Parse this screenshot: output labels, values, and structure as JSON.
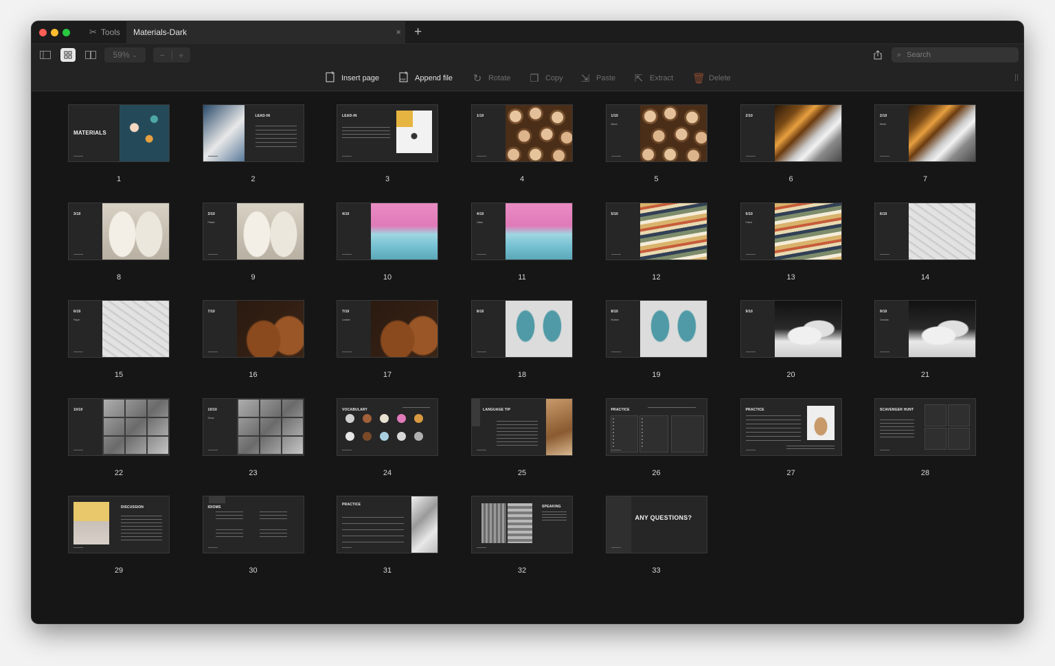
{
  "tabs": {
    "tools_label": "Tools",
    "document_title": "Materials-Dark",
    "close_glyph": "×",
    "new_tab_glyph": "+"
  },
  "toolbar": {
    "zoom_value": "59%",
    "zoom_out": "−",
    "zoom_in": "+",
    "search_placeholder": "Search"
  },
  "actions": [
    {
      "label": "Insert page",
      "icon": "insert-page-icon",
      "enabled": true
    },
    {
      "label": "Append file",
      "icon": "append-pdf-icon",
      "enabled": true
    },
    {
      "label": "Rotate",
      "icon": "rotate-icon",
      "enabled": false
    },
    {
      "label": "Copy",
      "icon": "copy-icon",
      "enabled": false
    },
    {
      "label": "Paste",
      "icon": "paste-icon",
      "enabled": false
    },
    {
      "label": "Extract",
      "icon": "extract-icon",
      "enabled": false
    },
    {
      "label": "Delete",
      "icon": "trash-icon",
      "enabled": false
    }
  ],
  "pages": [
    {
      "n": "1",
      "title": "MATERIALS",
      "sub": "",
      "img": "cover"
    },
    {
      "n": "2",
      "title": "LEAD-IN",
      "sub": "",
      "img": "leadin"
    },
    {
      "n": "3",
      "title": "LEAD-IN",
      "sub": "",
      "img": "leadin3"
    },
    {
      "n": "4",
      "title": "1/10",
      "sub": "",
      "img": "wood"
    },
    {
      "n": "5",
      "title": "1/10",
      "sub": "Wood",
      "img": "wood"
    },
    {
      "n": "6",
      "title": "2/10",
      "sub": "",
      "img": "metal"
    },
    {
      "n": "7",
      "title": "2/10",
      "sub": "Metal",
      "img": "metal"
    },
    {
      "n": "8",
      "title": "3/10",
      "sub": "",
      "img": "plastic"
    },
    {
      "n": "9",
      "title": "3/10",
      "sub": "Plastic",
      "img": "plastic"
    },
    {
      "n": "10",
      "title": "4/10",
      "sub": "",
      "img": "glass"
    },
    {
      "n": "11",
      "title": "4/10",
      "sub": "Glass",
      "img": "glass"
    },
    {
      "n": "12",
      "title": "5/10",
      "sub": "",
      "img": "fabric"
    },
    {
      "n": "13",
      "title": "5/10",
      "sub": "Fabric",
      "img": "fabric"
    },
    {
      "n": "14",
      "title": "6/10",
      "sub": "",
      "img": "paper"
    },
    {
      "n": "15",
      "title": "6/10",
      "sub": "Paper",
      "img": "paper"
    },
    {
      "n": "16",
      "title": "7/10",
      "sub": "",
      "img": "leather"
    },
    {
      "n": "17",
      "title": "7/10",
      "sub": "Leather",
      "img": "leather"
    },
    {
      "n": "18",
      "title": "8/10",
      "sub": "",
      "img": "rubber"
    },
    {
      "n": "19",
      "title": "8/10",
      "sub": "Rubber",
      "img": "rubber"
    },
    {
      "n": "20",
      "title": "9/10",
      "sub": "",
      "img": "ceramic"
    },
    {
      "n": "21",
      "title": "9/10",
      "sub": "Ceramic",
      "img": "ceramic"
    },
    {
      "n": "22",
      "title": "10/10",
      "sub": "",
      "img": "stone"
    },
    {
      "n": "23",
      "title": "10/10",
      "sub": "Stone",
      "img": "stone"
    },
    {
      "n": "24",
      "title": "VOCABULARY",
      "sub": "",
      "img": "vocab"
    },
    {
      "n": "25",
      "title": "LANGUAGE TIP",
      "sub": "",
      "img": "tip"
    },
    {
      "n": "26",
      "title": "PRACTICE",
      "sub": "",
      "img": "table"
    },
    {
      "n": "27",
      "title": "PRACTICE",
      "sub": "",
      "img": "practice27"
    },
    {
      "n": "28",
      "title": "SCAVENGER HUNT",
      "sub": "",
      "img": "hunt"
    },
    {
      "n": "29",
      "title": "DISCUSSION",
      "sub": "",
      "img": "discussion"
    },
    {
      "n": "30",
      "title": "IDIOMS",
      "sub": "",
      "img": "idioms"
    },
    {
      "n": "31",
      "title": "PRACTICE",
      "sub": "",
      "img": "practice31"
    },
    {
      "n": "32",
      "title": "SPEAKING",
      "sub": "",
      "img": "speaking"
    },
    {
      "n": "33",
      "title": "ANY QUESTIONS?",
      "sub": "",
      "img": "questions"
    }
  ]
}
